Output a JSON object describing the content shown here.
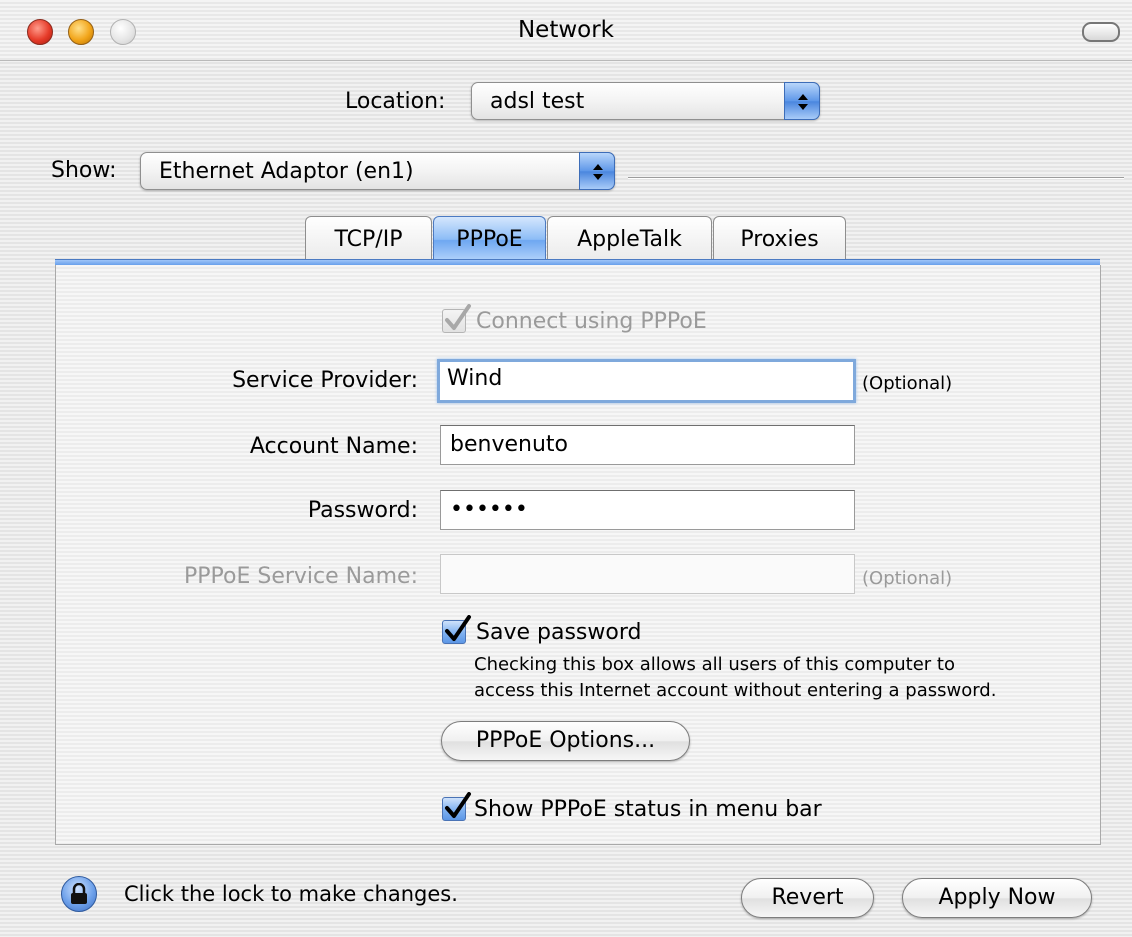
{
  "window": {
    "title": "Network"
  },
  "location": {
    "label": "Location:",
    "value": "adsl test"
  },
  "show": {
    "label": "Show:",
    "value": "Ethernet Adaptor (en1)"
  },
  "tabs": [
    {
      "label": "TCP/IP",
      "selected": false
    },
    {
      "label": "PPPoE",
      "selected": true
    },
    {
      "label": "AppleTalk",
      "selected": false
    },
    {
      "label": "Proxies",
      "selected": false
    }
  ],
  "pppoe": {
    "connect_label": "Connect using PPPoE",
    "connect_checked": true,
    "service_provider": {
      "label": "Service Provider:",
      "value": "Wind",
      "note": "(Optional)"
    },
    "account_name": {
      "label": "Account Name:",
      "value": "benvenuto"
    },
    "password": {
      "label": "Password:",
      "value": "••••••"
    },
    "service_name": {
      "label": "PPPoE Service Name:",
      "value": "",
      "note": "(Optional)"
    },
    "save_password": {
      "label": "Save password",
      "checked": true,
      "help_line1": "Checking this box allows all users of this computer to",
      "help_line2": "access this Internet account without entering a password."
    },
    "options_button": "PPPoE Options...",
    "show_status": {
      "label": "Show PPPoE status in menu bar",
      "checked": true
    }
  },
  "footer": {
    "lock_text": "Click the lock to make changes.",
    "revert": "Revert",
    "apply": "Apply Now"
  },
  "colors": {
    "accent": "#6ea7f1",
    "focus_ring": "#7fa9dc"
  }
}
